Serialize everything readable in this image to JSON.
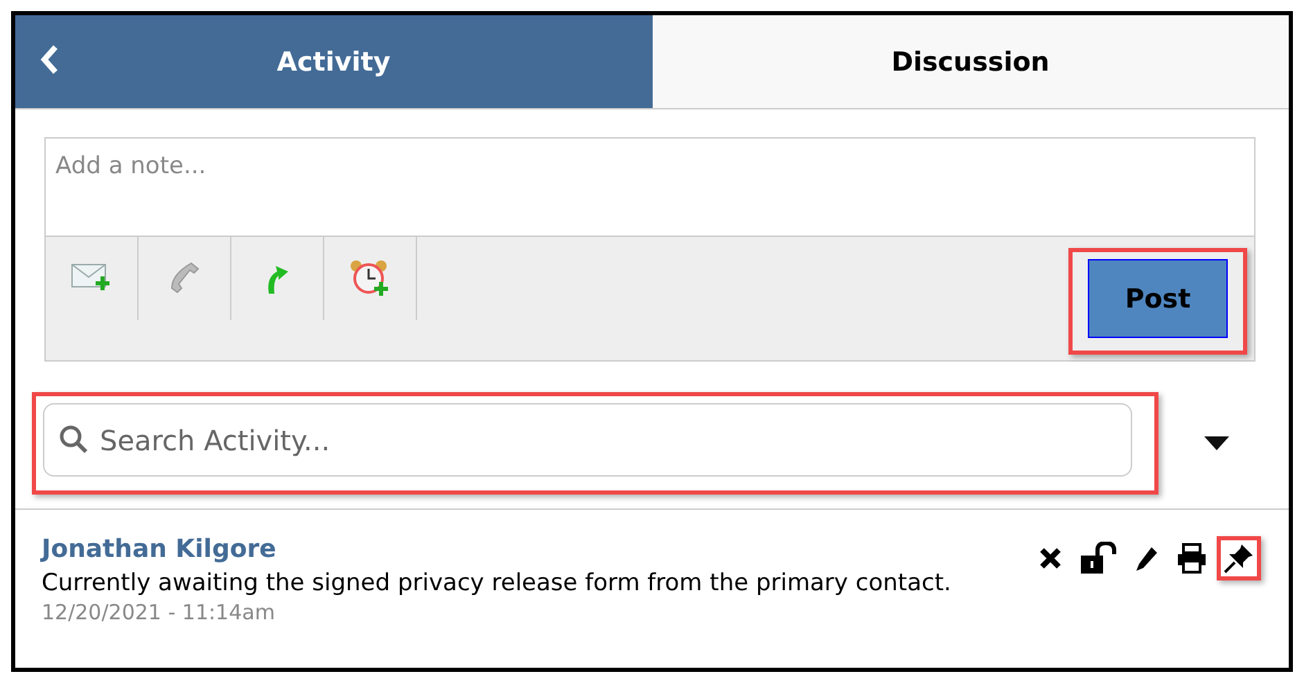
{
  "tabs": [
    {
      "label": "Activity",
      "selected": true
    },
    {
      "label": "Discussion",
      "selected": false
    }
  ],
  "note": {
    "placeholder": "Add a note...",
    "tools": [
      {
        "kind": "email"
      },
      {
        "kind": "phone"
      },
      {
        "kind": "followup"
      },
      {
        "kind": "reminder"
      }
    ],
    "post_button": {
      "label": "Post",
      "highlighted": true
    }
  },
  "search": {
    "placeholder": "Search Activity...",
    "highlighted": true
  },
  "entries": [
    {
      "author": "Jonathan Kilgore",
      "text": "Currently awaiting the signed privacy release form from the primary contact.",
      "timestamp": "12/20/2021 - 11:14am",
      "actions": [
        {
          "kind": "delete",
          "highlighted": false
        },
        {
          "kind": "unlock",
          "highlighted": false
        },
        {
          "kind": "edit",
          "highlighted": false
        },
        {
          "kind": "print",
          "highlighted": false
        },
        {
          "kind": "pin",
          "highlighted": true
        }
      ]
    }
  ]
}
